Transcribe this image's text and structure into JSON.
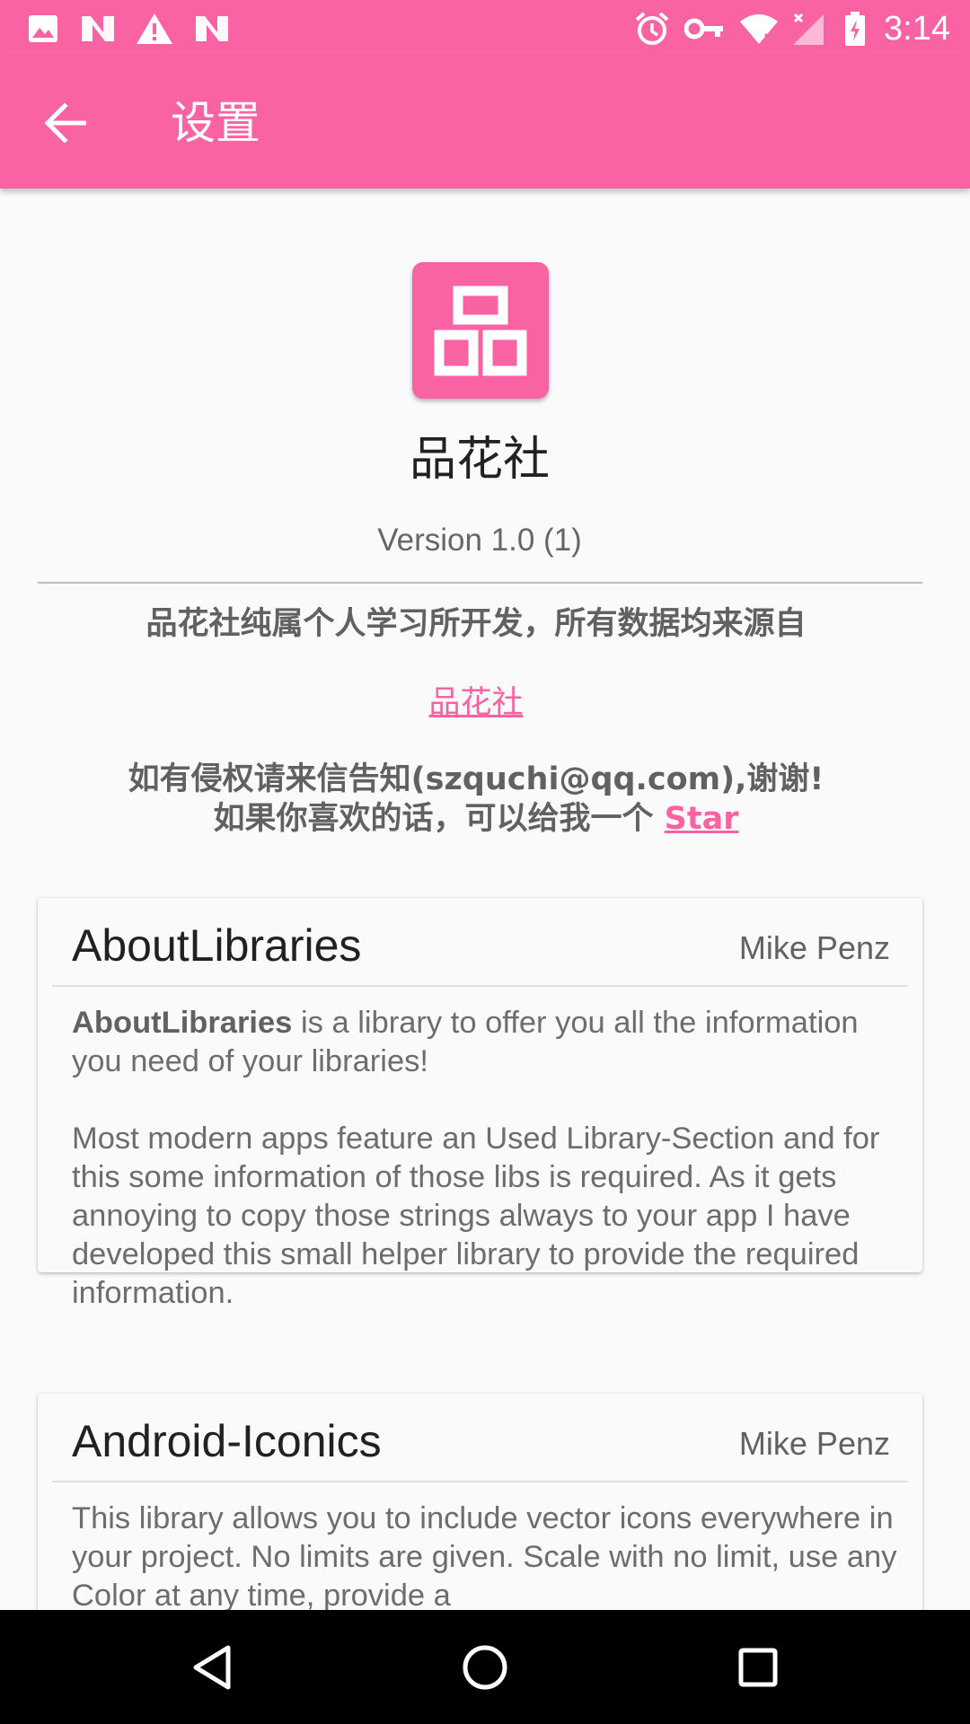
{
  "status_bar": {
    "time": "3:14",
    "left_icons": [
      "image-icon",
      "n-notification-icon",
      "warning-icon",
      "n-notification-icon"
    ],
    "right_icons": [
      "alarm-icon",
      "key-icon",
      "wifi-icon",
      "signal-icon",
      "battery-icon"
    ]
  },
  "toolbar": {
    "title": "设置",
    "back_icon": "arrow-back-icon"
  },
  "about": {
    "app_icon_glyph": "品",
    "app_name": "品花社",
    "version": "Version 1.0 (1)",
    "line1": "品花社纯属个人学习所开发，所有数据均来源自",
    "link": "品花社",
    "line3": "如有侵权请来信告知(szquchi@qq.com),谢谢!",
    "line4_prefix": "如果你喜欢的话，可以给我一个 ",
    "star_link": "Star"
  },
  "libraries": [
    {
      "name": "AboutLibraries",
      "author": "Mike Penz",
      "desc_bold": "AboutLibraries",
      "desc_p1_rest": " is a library to offer you all the information you need of your libraries!",
      "desc_p2": "Most modern apps feature an Used Library-Section and for this some information of those libs is required. As it gets annoying to copy those strings always to your app I have developed this small helper library to provide the required information."
    },
    {
      "name": "Android-Iconics",
      "author": "Mike Penz",
      "desc": "This library allows you to include vector icons everywhere in your project. No limits are given. Scale with no limit, use any Color at any time, provide a"
    }
  ],
  "colors": {
    "primary": "#f962a3",
    "nav_bar": "#000000"
  },
  "nav_bar": {
    "icons": [
      "back-triangle-icon",
      "home-circle-icon",
      "recents-square-icon"
    ]
  }
}
